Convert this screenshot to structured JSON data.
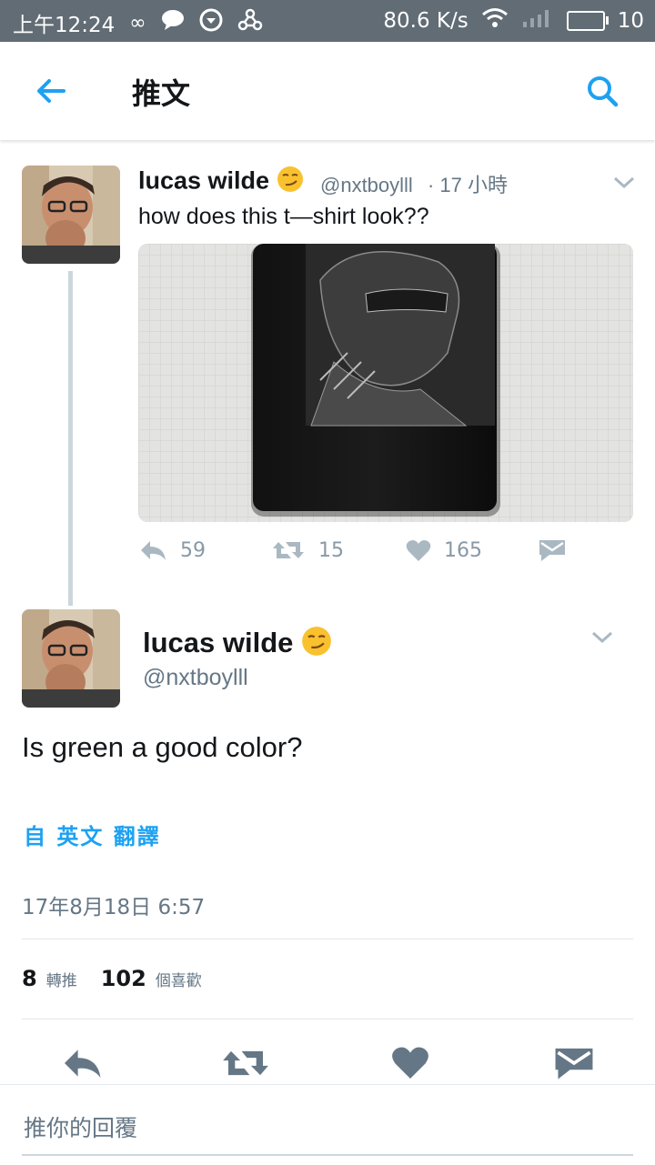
{
  "status_bar": {
    "time": "上午12:24",
    "speed": "80.6 K/s",
    "battery": "10",
    "icons": [
      "infinity-icon",
      "chat-bubble-icon",
      "download-icon",
      "share-icon",
      "wifi-icon",
      "signal-icon",
      "battery-icon"
    ]
  },
  "app_bar": {
    "title": "推文",
    "back_icon": "arrow-left-icon",
    "search_icon": "search-icon"
  },
  "parent_tweet": {
    "name": "lucas wilde",
    "emoji": "smirk-emoji",
    "handle": "@nxtboylll",
    "time": "· 17 小時",
    "text": "how does this t—shirt look??",
    "media_description": "black t-shirt with printed soldier image",
    "replies": "59",
    "retweets": "15",
    "likes": "165"
  },
  "main_tweet": {
    "name": "lucas wilde",
    "handle": "@nxtboylll",
    "text": "Is green a good color?",
    "translate": "自 英文 翻譯",
    "timestamp": "17年8月18日 6:57",
    "retweet_count": "8",
    "retweet_label": "轉推",
    "like_count": "102",
    "like_label": "個喜歡"
  },
  "reply_bar": {
    "placeholder": "推你的回覆"
  },
  "colors": {
    "accent": "#1da1f2",
    "status_bar": "#616c75",
    "muted": "#657786"
  }
}
